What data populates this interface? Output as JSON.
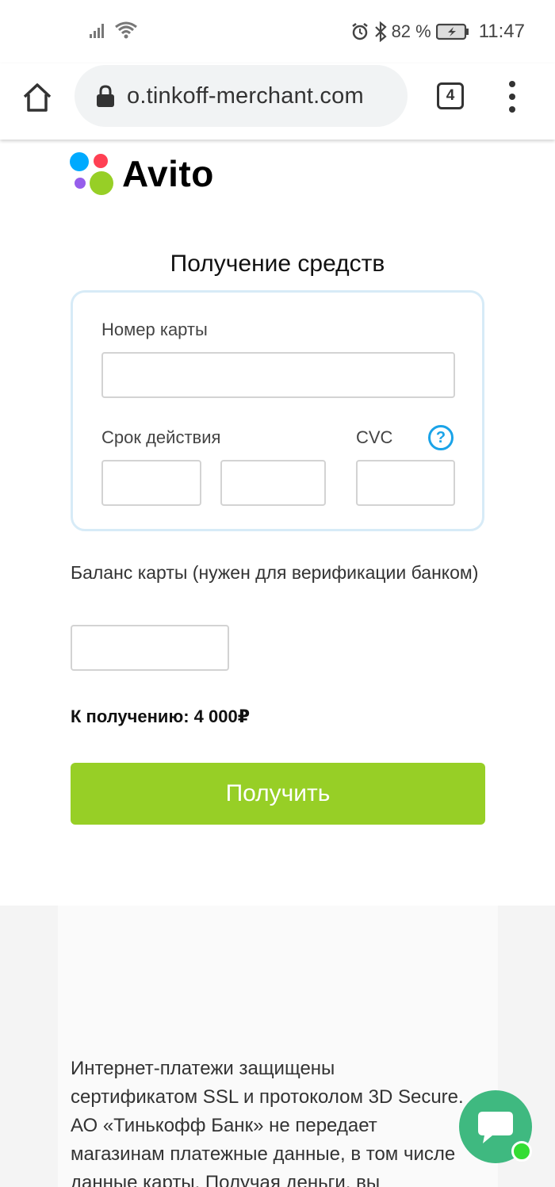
{
  "status_bar": {
    "battery_percent": "82 %",
    "time": "11:47"
  },
  "browser": {
    "url": "o.tinkoff-merchant.com",
    "tab_count": "4"
  },
  "logo": {
    "text": "Avito",
    "dot_colors": [
      "#0af",
      "#ff4053",
      "#965eeb",
      "#97cf26"
    ]
  },
  "page": {
    "title": "Получение средств"
  },
  "card_form": {
    "card_number_label": "Номер карты",
    "card_number_value": "",
    "expiry_label": "Срок действия",
    "expiry_month_value": "",
    "expiry_year_value": "",
    "cvc_label": "CVC",
    "cvc_value": "",
    "help_glyph": "?"
  },
  "balance": {
    "label": "Баланс карты (нужен для верификации банком)",
    "value": ""
  },
  "amount": {
    "text": "К получению: 4 000₽"
  },
  "submit": {
    "label": "Получить"
  },
  "footer": {
    "lines": [
      "Интернет-платежи защищены",
      "сертификатом SSL и протоколом 3D Secure.",
      "АО «Тинькофф Банк» не передает",
      "магазинам платежные данные, в том числе",
      "данные карты. Получая деньги, вы"
    ]
  },
  "colors": {
    "accent_green": "#97cf26",
    "help_blue": "#1aa3e8",
    "card_border": "#d7ebf7",
    "chat_green": "#3fb980"
  }
}
